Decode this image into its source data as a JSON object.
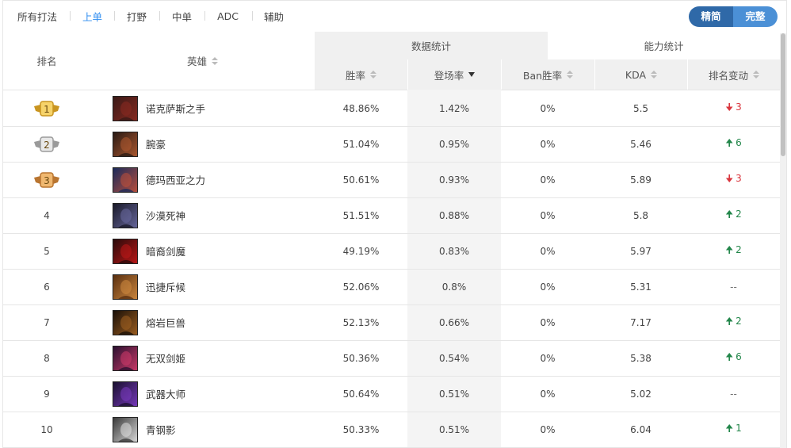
{
  "tabs": [
    {
      "label": "所有打法",
      "active": false
    },
    {
      "label": "上单",
      "active": true
    },
    {
      "label": "打野",
      "active": false
    },
    {
      "label": "中单",
      "active": false
    },
    {
      "label": "ADC",
      "active": false
    },
    {
      "label": "辅助",
      "active": false
    }
  ],
  "toggle": {
    "simple": "精简",
    "full": "完整"
  },
  "header": {
    "rank": "排名",
    "hero": "英雄",
    "group_data": "数据统计",
    "group_ability": "能力统计",
    "winrate": "胜率",
    "played": "登场率",
    "banrate": "Ban胜率",
    "kda": "KDA",
    "rank_change": "排名变动"
  },
  "colors": {
    "accent": "#2d8cf0",
    "up": "#22864a",
    "down": "#d9363e",
    "gold": "#e0b040",
    "silver": "#b9b9b9",
    "bronze": "#d49a4a"
  },
  "rows": [
    {
      "rank": "1",
      "medal": "gold",
      "hero": "诺克萨斯之手",
      "winrate": "48.86%",
      "played": "1.42%",
      "ban": "0%",
      "kda": "5.5",
      "dir": "down",
      "change": "3",
      "avatar": [
        "#3a1a18",
        "#8a2a20"
      ]
    },
    {
      "rank": "2",
      "medal": "silver",
      "hero": "腕豪",
      "winrate": "51.04%",
      "played": "0.95%",
      "ban": "0%",
      "kda": "5.46",
      "dir": "up",
      "change": "6",
      "avatar": [
        "#2a1a14",
        "#b05a30"
      ]
    },
    {
      "rank": "3",
      "medal": "bronze",
      "hero": "德玛西亚之力",
      "winrate": "50.61%",
      "played": "0.93%",
      "ban": "0%",
      "kda": "5.89",
      "dir": "down",
      "change": "3",
      "avatar": [
        "#1a2a5a",
        "#c0503a"
      ]
    },
    {
      "rank": "4",
      "medal": "",
      "hero": "沙漠死神",
      "winrate": "51.51%",
      "played": "0.88%",
      "ban": "0%",
      "kda": "5.8",
      "dir": "up",
      "change": "2",
      "avatar": [
        "#1a1a2a",
        "#6a6aa0"
      ]
    },
    {
      "rank": "5",
      "medal": "",
      "hero": "暗裔剑魔",
      "winrate": "49.19%",
      "played": "0.83%",
      "ban": "0%",
      "kda": "5.97",
      "dir": "up",
      "change": "2",
      "avatar": [
        "#2a0a0a",
        "#c01818"
      ]
    },
    {
      "rank": "6",
      "medal": "",
      "hero": "迅捷斥候",
      "winrate": "52.06%",
      "played": "0.8%",
      "ban": "0%",
      "kda": "5.31",
      "dir": "none",
      "change": "--",
      "avatar": [
        "#5a3010",
        "#d08a40"
      ]
    },
    {
      "rank": "7",
      "medal": "",
      "hero": "熔岩巨兽",
      "winrate": "52.13%",
      "played": "0.66%",
      "ban": "0%",
      "kda": "7.17",
      "dir": "up",
      "change": "2",
      "avatar": [
        "#1a1008",
        "#a06020"
      ]
    },
    {
      "rank": "8",
      "medal": "",
      "hero": "无双剑姬",
      "winrate": "50.36%",
      "played": "0.54%",
      "ban": "0%",
      "kda": "5.38",
      "dir": "up",
      "change": "6",
      "avatar": [
        "#2a1030",
        "#d03a6a"
      ]
    },
    {
      "rank": "9",
      "medal": "",
      "hero": "武器大师",
      "winrate": "50.64%",
      "played": "0.51%",
      "ban": "0%",
      "kda": "5.02",
      "dir": "none",
      "change": "--",
      "avatar": [
        "#1a1030",
        "#7a3ac0"
      ]
    },
    {
      "rank": "10",
      "medal": "",
      "hero": "青钢影",
      "winrate": "50.33%",
      "played": "0.51%",
      "ban": "0%",
      "kda": "6.04",
      "dir": "up",
      "change": "1",
      "avatar": [
        "#3a3a3a",
        "#e0e0e0"
      ]
    }
  ]
}
